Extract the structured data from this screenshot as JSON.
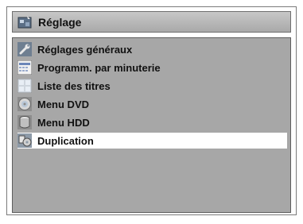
{
  "header": {
    "title": "Réglage",
    "icon": "setup-icon"
  },
  "menu": {
    "items": [
      {
        "label": "Réglages généraux",
        "icon": "wrench-icon"
      },
      {
        "label": "Programm. par minuterie",
        "icon": "timer-program-icon"
      },
      {
        "label": "Liste des titres",
        "icon": "title-list-icon"
      },
      {
        "label": "Menu DVD",
        "icon": "disc-icon"
      },
      {
        "label": "Menu HDD",
        "icon": "hdd-icon"
      },
      {
        "label": "Duplication",
        "icon": "duplication-icon",
        "selected": true
      }
    ]
  },
  "colors": {
    "panel": "#a7a7a7",
    "header": "#b8b8b8",
    "selected": "#ffffff"
  }
}
